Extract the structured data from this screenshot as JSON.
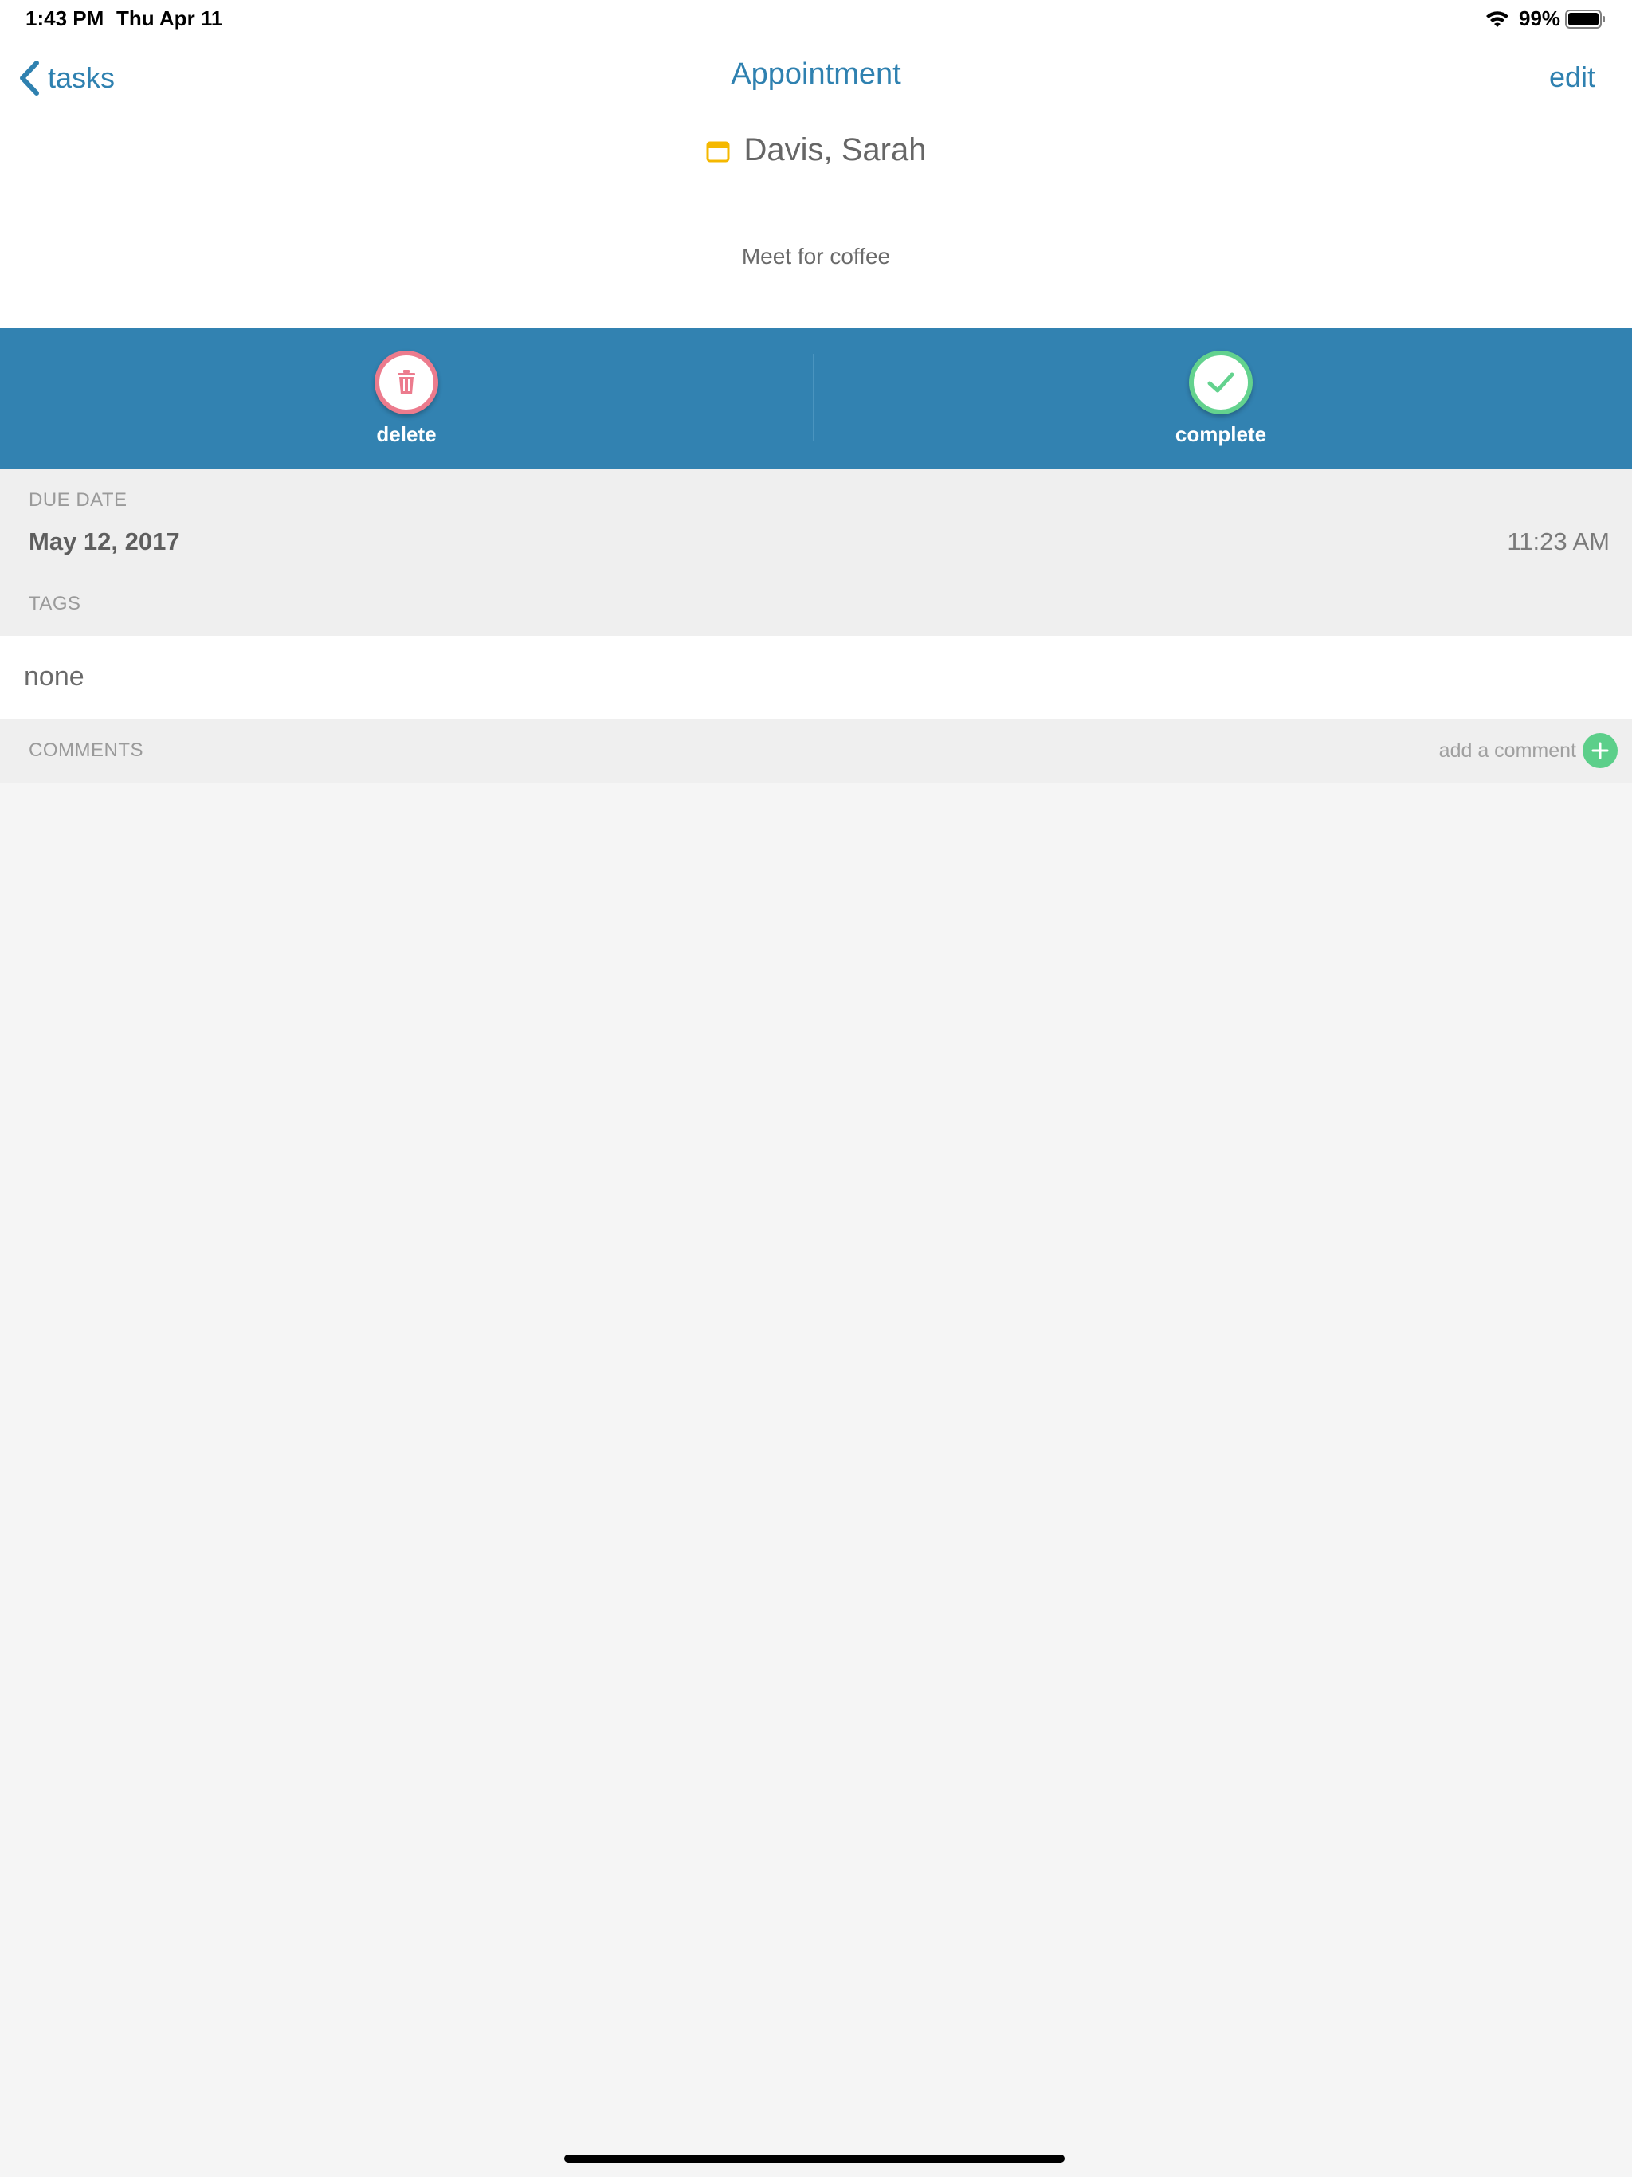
{
  "status_bar": {
    "time": "1:43 PM",
    "date": "Thu Apr 11",
    "battery": "99%"
  },
  "nav": {
    "back_label": "tasks",
    "title": "Appointment",
    "edit_label": "edit"
  },
  "task": {
    "contact_name": "Davis, Sarah",
    "description": "Meet for coffee"
  },
  "actions": {
    "delete_label": "delete",
    "complete_label": "complete"
  },
  "due_date": {
    "label": "DUE DATE",
    "date": "May 12, 2017",
    "time": "11:23 AM"
  },
  "tags": {
    "label": "TAGS",
    "value": "none"
  },
  "comments": {
    "label": "COMMENTS",
    "add_label": "add a comment"
  },
  "colors": {
    "accent": "#2f81b0",
    "action_bar": "#3282b1",
    "delete": "#ec7b8d",
    "complete": "#63d28e",
    "calendar": "#f5b800"
  },
  "icons": {
    "back": "chevron-left-icon",
    "calendar": "calendar-icon",
    "delete": "trash-icon",
    "complete": "checkmark-icon",
    "add": "plus-icon"
  }
}
